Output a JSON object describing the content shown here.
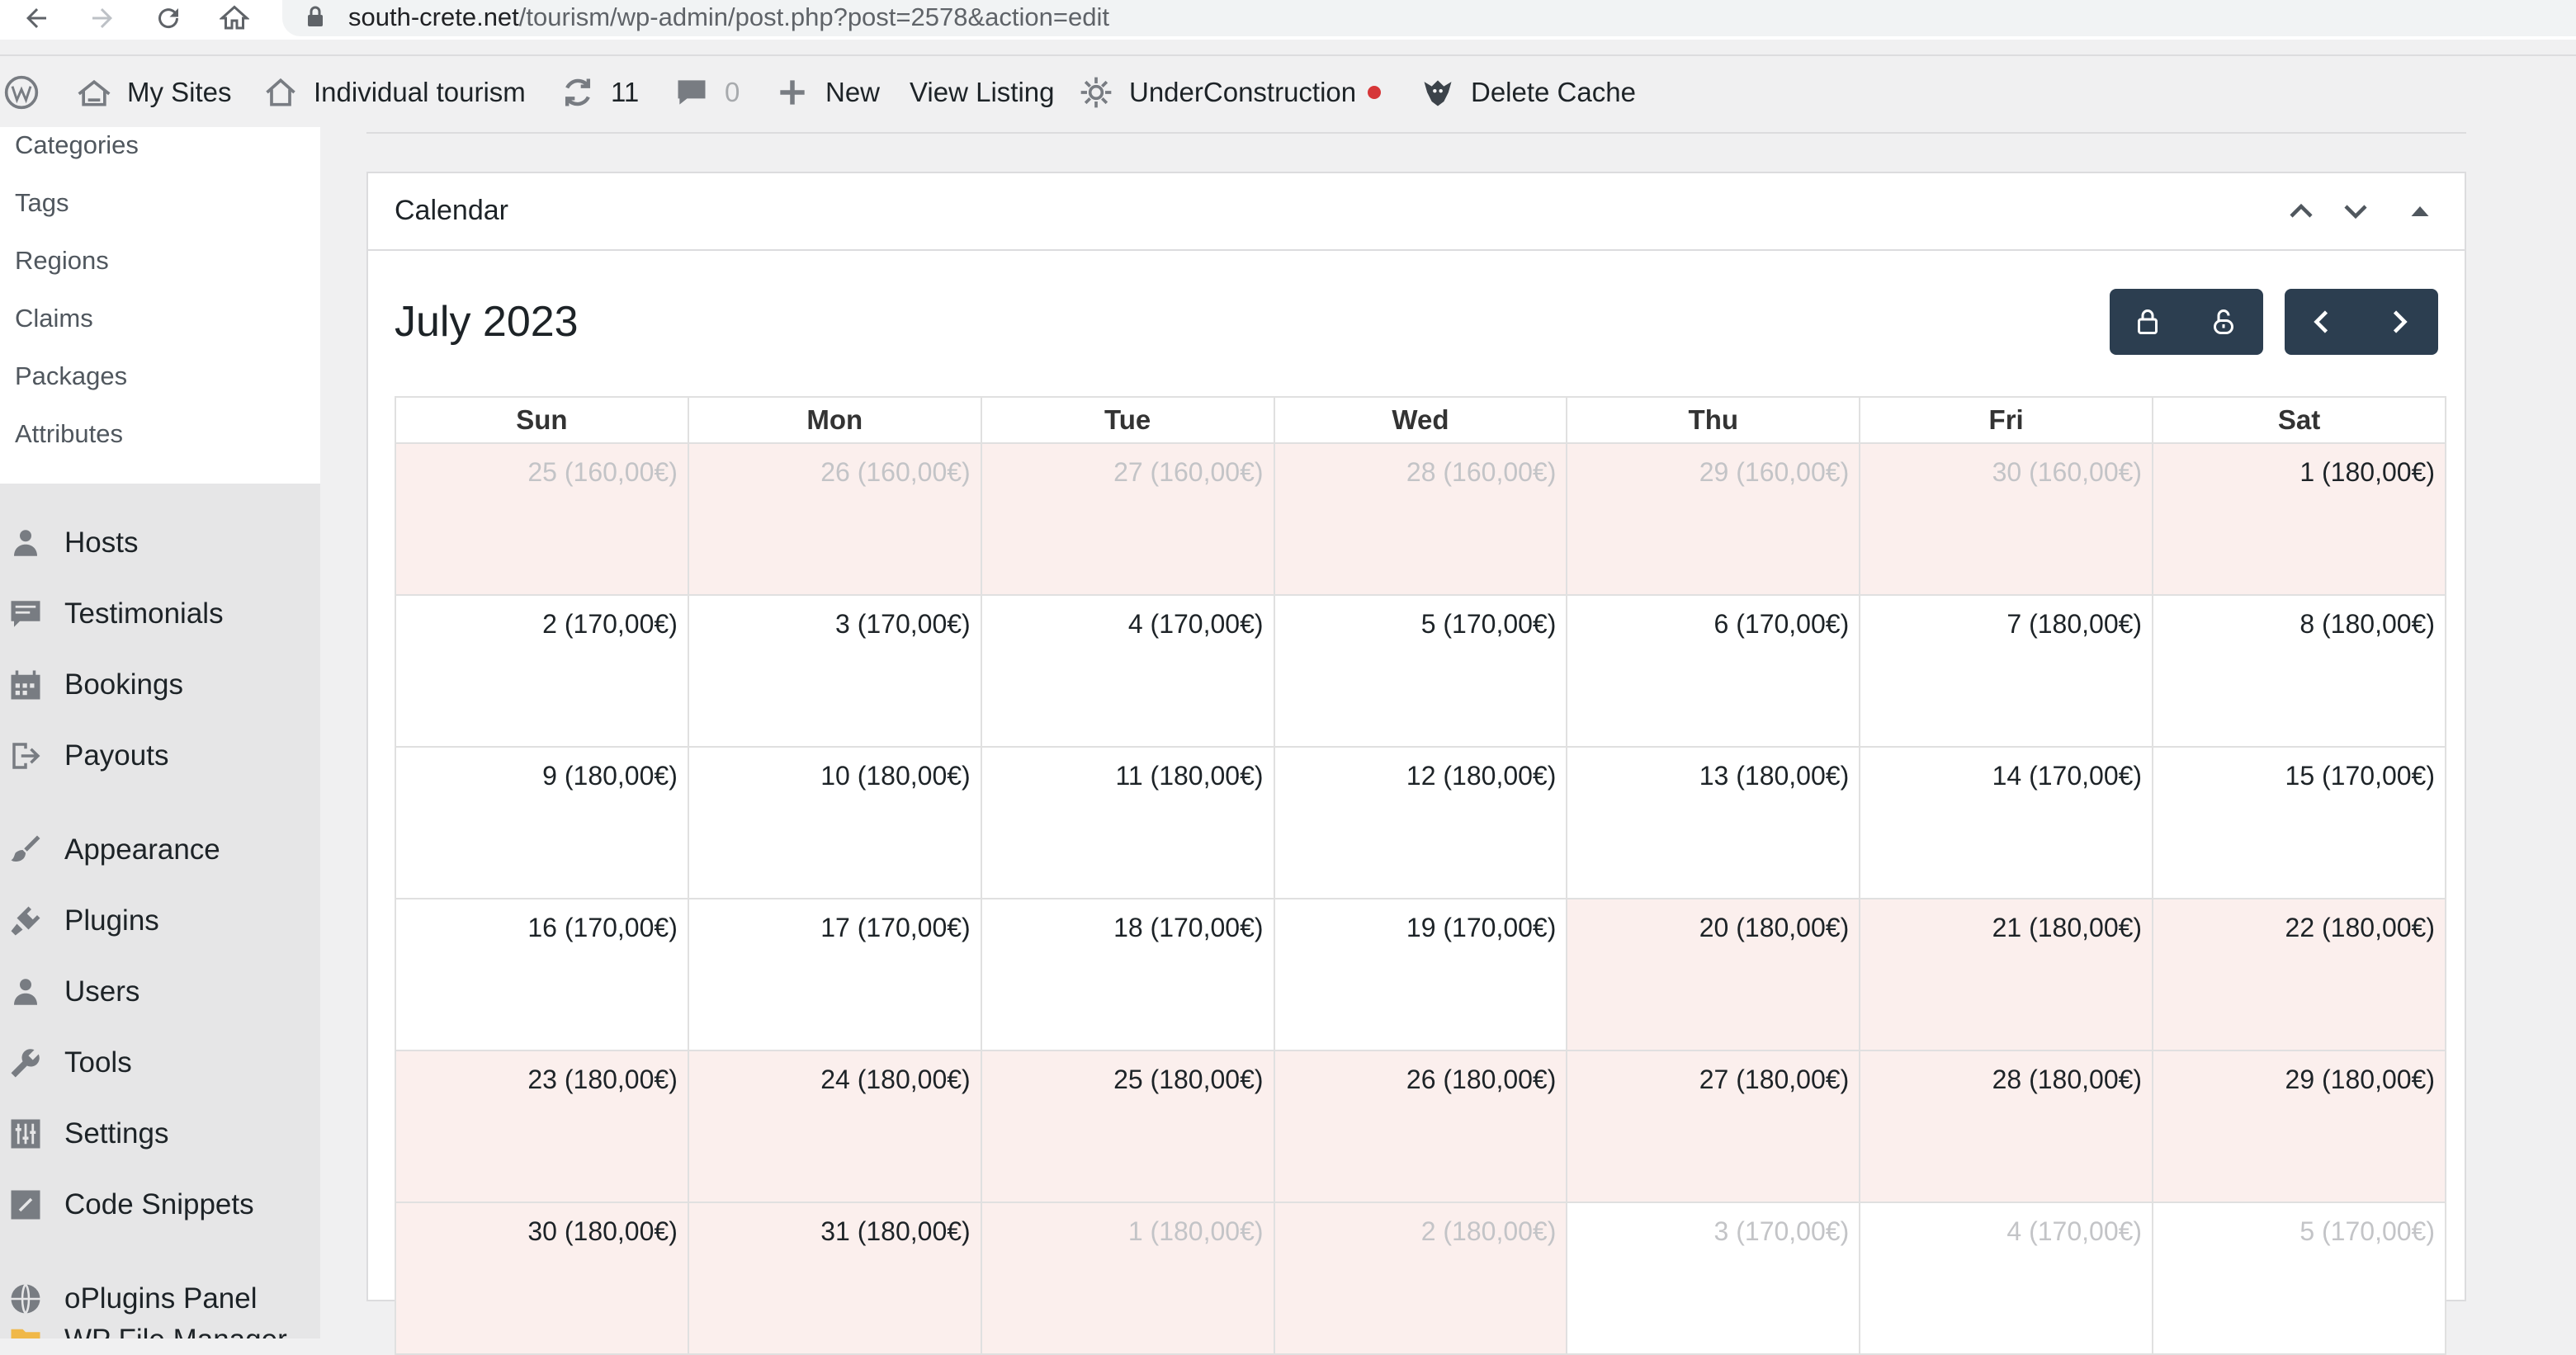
{
  "browser": {
    "url_host": "south-crete.net",
    "url_path": "/tourism/wp-admin/post.php?post=2578&action=edit"
  },
  "adminbar": {
    "my_sites": "My Sites",
    "site_name": "Individual tourism",
    "updates_count": "11",
    "comments_count": "0",
    "new_label": "New",
    "view_listing": "View Listing",
    "under_construction": "UnderConstruction",
    "delete_cache": "Delete Cache"
  },
  "sidebar": {
    "submenu": [
      "Categories",
      "Tags",
      "Regions",
      "Claims",
      "Packages",
      "Attributes"
    ],
    "menu": {
      "hosts": "Hosts",
      "testimonials": "Testimonials",
      "bookings": "Bookings",
      "payouts": "Payouts",
      "appearance": "Appearance",
      "plugins": "Plugins",
      "users": "Users",
      "tools": "Tools",
      "settings": "Settings",
      "code_snippets": "Code Snippets",
      "oplugins_panel": "oPlugins Panel",
      "wp_file_manager": "WP File Manager"
    }
  },
  "calendar": {
    "panel_title": "Calendar",
    "month_label": "July 2023",
    "weekdays": [
      "Sun",
      "Mon",
      "Tue",
      "Wed",
      "Thu",
      "Fri",
      "Sat"
    ],
    "weeks": [
      [
        {
          "text": "25 (160,00€)",
          "state": "booked-other"
        },
        {
          "text": "26 (160,00€)",
          "state": "booked-other"
        },
        {
          "text": "27 (160,00€)",
          "state": "booked-other"
        },
        {
          "text": "28 (160,00€)",
          "state": "booked-other"
        },
        {
          "text": "29 (160,00€)",
          "state": "booked-other"
        },
        {
          "text": "30 (160,00€)",
          "state": "booked-other"
        },
        {
          "text": "1 (180,00€)",
          "state": "booked"
        }
      ],
      [
        {
          "text": "2 (170,00€)",
          "state": "free"
        },
        {
          "text": "3 (170,00€)",
          "state": "free"
        },
        {
          "text": "4 (170,00€)",
          "state": "free"
        },
        {
          "text": "5 (170,00€)",
          "state": "free"
        },
        {
          "text": "6 (170,00€)",
          "state": "free"
        },
        {
          "text": "7 (180,00€)",
          "state": "free"
        },
        {
          "text": "8 (180,00€)",
          "state": "free"
        }
      ],
      [
        {
          "text": "9 (180,00€)",
          "state": "free"
        },
        {
          "text": "10 (180,00€)",
          "state": "free"
        },
        {
          "text": "11 (180,00€)",
          "state": "free"
        },
        {
          "text": "12 (180,00€)",
          "state": "free"
        },
        {
          "text": "13 (180,00€)",
          "state": "free"
        },
        {
          "text": "14 (170,00€)",
          "state": "free"
        },
        {
          "text": "15 (170,00€)",
          "state": "free"
        }
      ],
      [
        {
          "text": "16 (170,00€)",
          "state": "free"
        },
        {
          "text": "17 (170,00€)",
          "state": "free"
        },
        {
          "text": "18 (170,00€)",
          "state": "free"
        },
        {
          "text": "19 (170,00€)",
          "state": "free"
        },
        {
          "text": "20 (180,00€)",
          "state": "booked"
        },
        {
          "text": "21 (180,00€)",
          "state": "booked"
        },
        {
          "text": "22 (180,00€)",
          "state": "booked"
        }
      ],
      [
        {
          "text": "23 (180,00€)",
          "state": "booked"
        },
        {
          "text": "24 (180,00€)",
          "state": "booked"
        },
        {
          "text": "25 (180,00€)",
          "state": "booked"
        },
        {
          "text": "26 (180,00€)",
          "state": "booked"
        },
        {
          "text": "27 (180,00€)",
          "state": "booked"
        },
        {
          "text": "28 (180,00€)",
          "state": "booked"
        },
        {
          "text": "29 (180,00€)",
          "state": "booked"
        }
      ],
      [
        {
          "text": "30 (180,00€)",
          "state": "booked"
        },
        {
          "text": "31 (180,00€)",
          "state": "booked"
        },
        {
          "text": "1 (180,00€)",
          "state": "booked-other"
        },
        {
          "text": "2 (180,00€)",
          "state": "booked-other"
        },
        {
          "text": "3 (170,00€)",
          "state": "other"
        },
        {
          "text": "4 (170,00€)",
          "state": "other"
        },
        {
          "text": "5 (170,00€)",
          "state": "other"
        }
      ]
    ]
  },
  "colors": {
    "booked_bg": "#fbefed",
    "button_bg": "#2c3e50",
    "other_month_text": "#c3c4c7",
    "notice_dot": "#d63638"
  }
}
